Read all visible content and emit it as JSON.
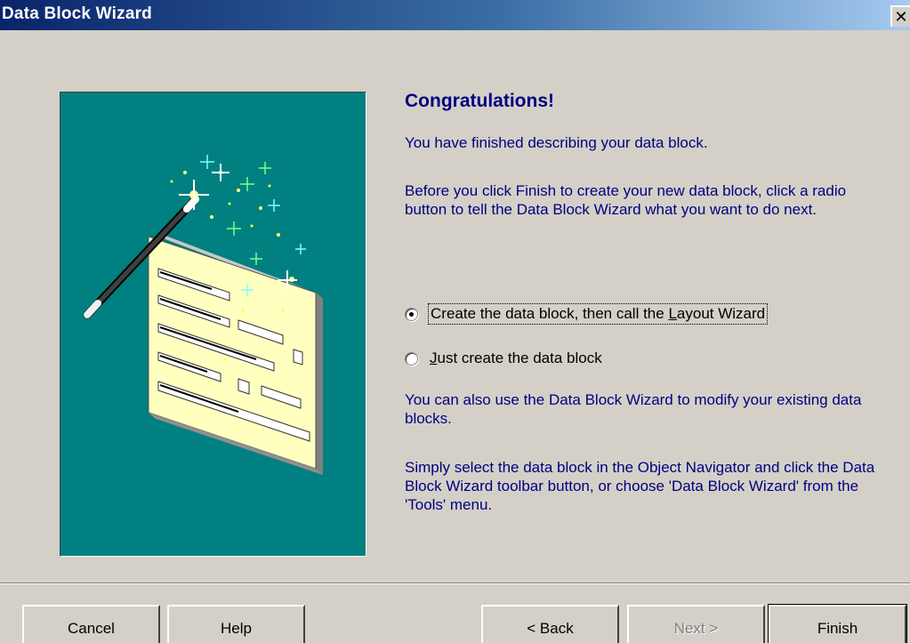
{
  "window": {
    "title": "Data Block Wizard",
    "close_glyph": "✕"
  },
  "content": {
    "heading": "Congratulations!",
    "paragraph_finished": "You have finished describing your data block.",
    "paragraph_instruction": "Before you click Finish to create your new data block, click a radio button to tell the Data Block Wizard what you want to do next.",
    "paragraph_modify": "You can also use the Data Block Wizard to modify your existing data blocks.",
    "paragraph_select": "Simply select the data block in the Object Navigator and click the Data Block Wizard toolbar button, or choose 'Data Block Wizard' from the 'Tools' menu."
  },
  "options": {
    "create_then_layout": {
      "label_before": "Create the data block, then call the ",
      "label_accel": "L",
      "label_after": "ayout Wizard",
      "selected": true
    },
    "just_create": {
      "label_accel": "J",
      "label_after": "ust create the data block",
      "selected": false
    }
  },
  "buttons": {
    "cancel": "Cancel",
    "help": "Help",
    "back": "< Back",
    "next": "Next >",
    "finish": "Finish"
  },
  "colors": {
    "title_bar": "#0a246a",
    "dialog_bg": "#d4d0c8",
    "text_accent": "#000080",
    "illustration_bg": "#008080"
  },
  "icons": {
    "illustration": "magic-wand-form-illustration",
    "close": "close-icon"
  }
}
